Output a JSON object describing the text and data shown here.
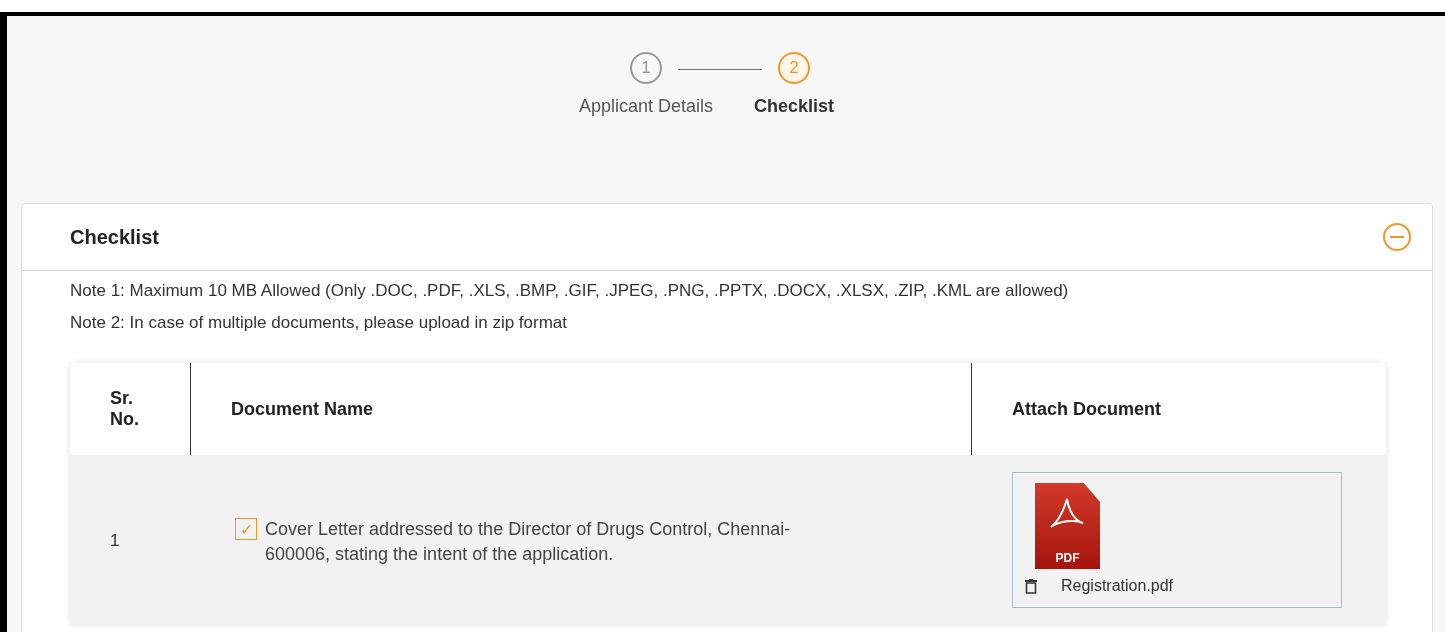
{
  "stepper": {
    "steps": [
      {
        "number": "1",
        "label": "Applicant Details",
        "selected": false
      },
      {
        "number": "2",
        "label": "Checklist",
        "selected": true
      }
    ]
  },
  "panel": {
    "title": "Checklist",
    "expanded": true,
    "notes": [
      "Note 1: Maximum 10 MB Allowed (Only .DOC, .PDF, .XLS, .BMP, .GIF, .JPEG, .PNG, .PPTX, .DOCX, .XLSX, .ZIP, .KML are allowed)",
      "Note 2: In case of multiple documents, please upload in zip format"
    ],
    "table": {
      "columns": [
        "Sr.\nNo.",
        "Document Name",
        "Attach Document"
      ],
      "rows": [
        {
          "sr": "1",
          "checked": true,
          "check_mark": "✓",
          "document": "Cover Letter addressed to the Director of Drugs Control, Chennai-600006, stating the intent of the application.",
          "file_badge": "PDF",
          "file_name": "Registration.pdf"
        }
      ]
    }
  }
}
